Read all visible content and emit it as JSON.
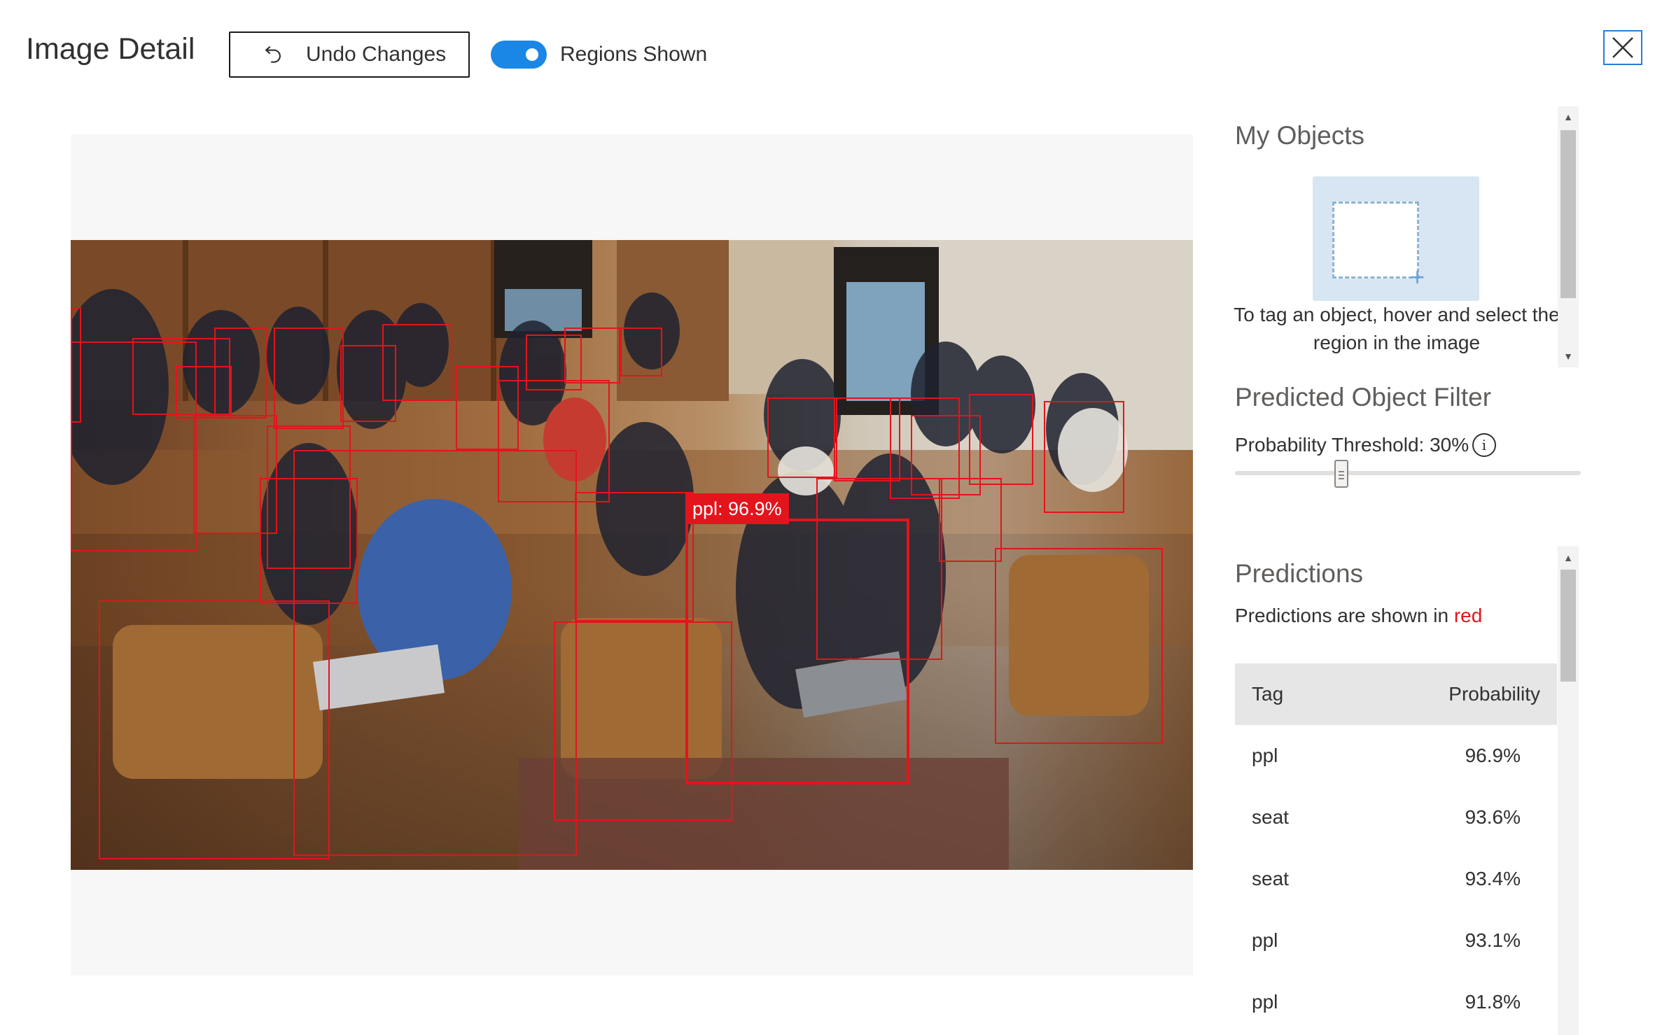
{
  "header": {
    "title": "Image Detail",
    "undo_label": "Undo Changes",
    "toggle_label": "Regions Shown",
    "toggle_on": true
  },
  "colors": {
    "accent": "#1a86e6",
    "prediction_red": "#e3141c",
    "tag_box": "#d7e6f2"
  },
  "icons": {
    "undo": "undo-icon",
    "close": "close-icon",
    "info": "info-icon"
  },
  "image": {
    "selected_label": "ppl: 96.9%"
  },
  "my_objects": {
    "heading": "My Objects",
    "hint": "To tag an object, hover and select the region in the image"
  },
  "filter": {
    "heading": "Predicted Object Filter",
    "threshold_label": "Probability Threshold: 30%",
    "threshold_value": 0.3
  },
  "predictions": {
    "heading": "Predictions",
    "note_prefix": "Predictions are shown in ",
    "note_color_word": "red",
    "columns": {
      "tag": "Tag",
      "probability": "Probability"
    },
    "rows": [
      {
        "tag": "ppl",
        "probability": "96.9%"
      },
      {
        "tag": "seat",
        "probability": "93.6%"
      },
      {
        "tag": "seat",
        "probability": "93.4%"
      },
      {
        "tag": "ppl",
        "probability": "93.1%"
      },
      {
        "tag": "ppl",
        "probability": "91.8%"
      }
    ]
  }
}
